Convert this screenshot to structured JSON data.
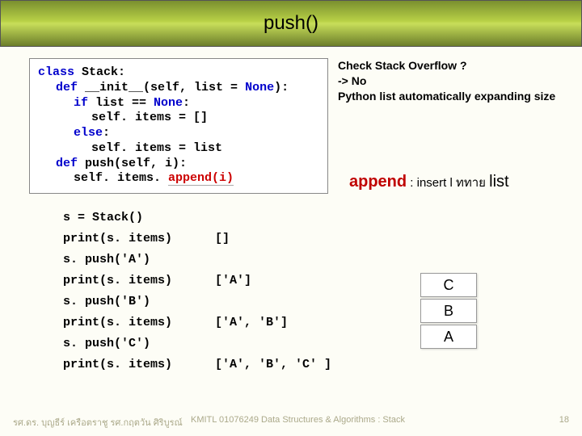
{
  "title": "push()",
  "code": {
    "l1a": "class ",
    "l1b": "Stack",
    "l1c": ":",
    "l2a": "def ",
    "l2b": "__init__(self, list = ",
    "l2c": "None",
    "l2d": "):",
    "l3a": "if ",
    "l3b": "list == ",
    "l3c": "None",
    "l3d": ":",
    "l4": "self. items = []",
    "l5a": "else",
    "l5b": ":",
    "l6": "self. items = list",
    "l7a": "def ",
    "l7b": "push(self, i):",
    "l8a": "self. items. ",
    "l8b": "append(i)"
  },
  "overflow": {
    "l1": "Check Stack Overflow ?",
    "l2": "-> No",
    "l3": "Python list automatically expanding size"
  },
  "append_note": {
    "word": "append",
    "mid": " : insert l ททาย     ",
    "list": "list"
  },
  "demo": {
    "r1a": "s = ",
    "r1b": "Stack",
    "r1c": "()",
    "r2": "print(s. items)",
    "o2": "[]",
    "r3": "s. push('A')",
    "r4": "print(s. items)",
    "o4": "['A']",
    "r5": "s. push('B')",
    "r6": "print(s. items)",
    "o6": "['A', 'B']",
    "r7": "s. push('C')",
    "r8": "print(s. items)",
    "o8": "['A', 'B', 'C' ]"
  },
  "stack": {
    "c": "C",
    "b": "B",
    "a": "A"
  },
  "footer": {
    "left": "รศ.ดร. บุญธีร์     เครือตราชู   รศ.กฤตวัน   ศิริบูรณ์",
    "mid": "KMITL   01076249 Data Structures & Algorithms : Stack",
    "page": "18"
  }
}
